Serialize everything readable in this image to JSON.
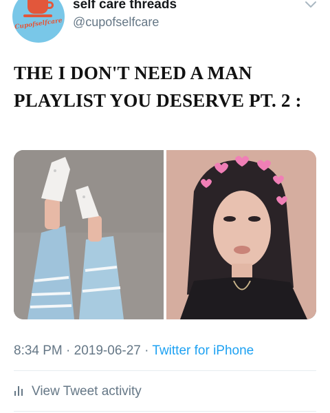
{
  "account": {
    "display_name": "self care threads",
    "handle": "@cupofselfcare",
    "avatar_text": "Cupofselfcare"
  },
  "tweet": {
    "text": "THE I DON'T NEED A MAN PLAYLIST YOU DESERVE PT. 2 :",
    "media": [
      {
        "description": "legs in ripped light-wash jeans and white sneakers"
      },
      {
        "description": "woman with dark hair wearing heart filter"
      }
    ]
  },
  "meta": {
    "time": "8:34 PM",
    "separator": " · ",
    "date": "2019-06-27",
    "source": "Twitter for iPhone"
  },
  "actions": {
    "view_activity": "View Tweet activity"
  },
  "colors": {
    "accent": "#1da1f2",
    "muted": "#657786",
    "avatar_bg": "#79c7e8",
    "avatar_cup": "#e2573b"
  }
}
